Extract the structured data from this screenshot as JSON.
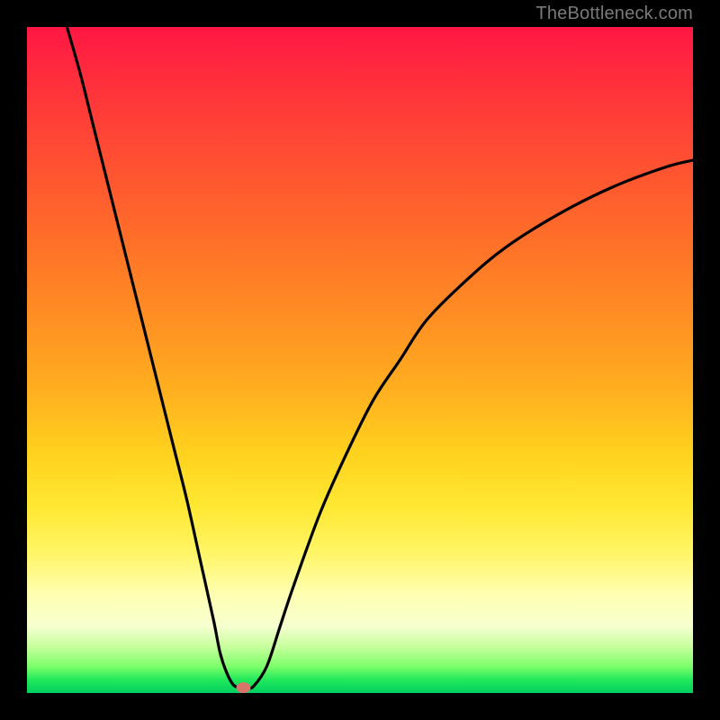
{
  "watermark": "TheBottleneck.com",
  "chart_data": {
    "type": "line",
    "title": "",
    "xlabel": "",
    "ylabel": "",
    "xlim": [
      0,
      100
    ],
    "ylim": [
      0,
      100
    ],
    "series": [
      {
        "name": "curve",
        "x": [
          6,
          8,
          10,
          12,
          14,
          16,
          18,
          20,
          22,
          24,
          26,
          28,
          29,
          30,
          31,
          32,
          33,
          34,
          36,
          38,
          40,
          44,
          48,
          52,
          56,
          60,
          66,
          72,
          80,
          88,
          96,
          100
        ],
        "y": [
          100,
          93,
          85,
          77,
          69,
          61,
          53,
          45,
          37,
          29,
          20,
          11,
          6,
          3,
          1.2,
          0.8,
          0.8,
          1.0,
          4,
          10,
          16,
          27,
          36,
          44,
          50,
          56,
          62,
          67,
          72,
          76,
          79,
          80
        ]
      }
    ],
    "marker": {
      "x": 32.5,
      "y": 0.8,
      "color": "#d9746b"
    },
    "colors": {
      "curve": "#000000",
      "background_gradient": [
        "#ff1744",
        "#ffd21e",
        "#ffffb0",
        "#00d060"
      ],
      "frame": "#000000"
    }
  }
}
